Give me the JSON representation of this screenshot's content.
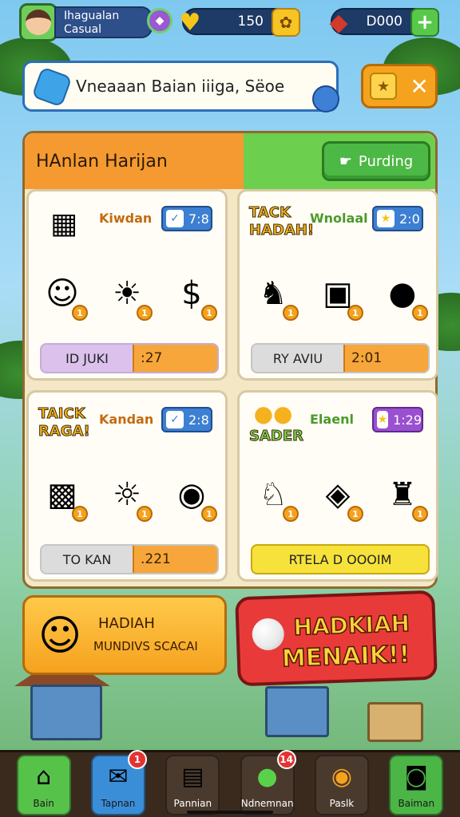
{
  "colors": {
    "accent_orange": "#f5a21e",
    "accent_green": "#57c24a",
    "accent_blue": "#3a8ed8",
    "danger_red": "#e93a3a"
  },
  "profile": {
    "name_line1": "Ihagualan",
    "name_line2": "Casual",
    "avatar_icon": "player-avatar"
  },
  "currencies": [
    {
      "icon": "heart-icon",
      "value": "150",
      "button_icon": "gift-icon"
    },
    {
      "icon": "gem-icon",
      "value": "D000",
      "button_label": "+"
    }
  ],
  "search": {
    "text": "Vneaaan Baian iiiga, Sëoe"
  },
  "close_panel": {
    "close_label": "✕",
    "star_label": "★"
  },
  "panel": {
    "title": "HAnlan Harijan",
    "pending_label": "Purding"
  },
  "cards": [
    {
      "title_art": "",
      "head_text": "Kiwdan",
      "badge": "7:8",
      "progress_label": "ID JUKI",
      "progress_value": ":27",
      "progress_fraction": 0.52
    },
    {
      "title_art": "TACK HADAH!",
      "head_text": "Wnolaal",
      "badge": "2:0",
      "progress_label": "RY AVIU",
      "progress_value": "2:01",
      "progress_fraction": 0.5
    },
    {
      "title_art": "TAICK RAGA!",
      "head_text": "Kandan",
      "badge": "2:8",
      "progress_label": "TO KAN",
      "progress_value": ".221",
      "progress_fraction": 0.52
    },
    {
      "title_art": "SADER",
      "head_text": "Elaenl",
      "badge": "1:29",
      "progress_label": "RTELA D OOOIM",
      "progress_value": "",
      "progress_fraction": 1.0
    }
  ],
  "card_items": [
    [
      "kid-icon",
      "sun-character-icon",
      "coin-icon"
    ],
    [
      "bear-icon",
      "tablet-icon",
      "purple-blob-icon"
    ],
    [
      "cube-icon",
      "sun-icon",
      "pink-orb-icon"
    ],
    [
      "teddy-icon",
      "green-gem-icon",
      "brown-bear-icon"
    ]
  ],
  "item_numbers": [
    "1",
    "1",
    "1"
  ],
  "promos": {
    "left_line1": "HADIAH",
    "left_line2": "MUNDIVS SCACAI",
    "right_line1": "HADKIAH",
    "right_line2": "MENAIK!!"
  },
  "nav": [
    {
      "label": "Bain",
      "icon": "home-icon",
      "badge": ""
    },
    {
      "label": "Tapnan",
      "icon": "scroll-icon",
      "badge": "1"
    },
    {
      "label": "Pannian",
      "icon": "chest-icon",
      "badge": ""
    },
    {
      "label": "Ndnemnan",
      "icon": "apple-icon",
      "badge": "14"
    },
    {
      "label": "Paslk",
      "icon": "coin-icon",
      "badge": ""
    },
    {
      "label": "Baiman",
      "icon": "camera-icon",
      "badge": ""
    }
  ]
}
